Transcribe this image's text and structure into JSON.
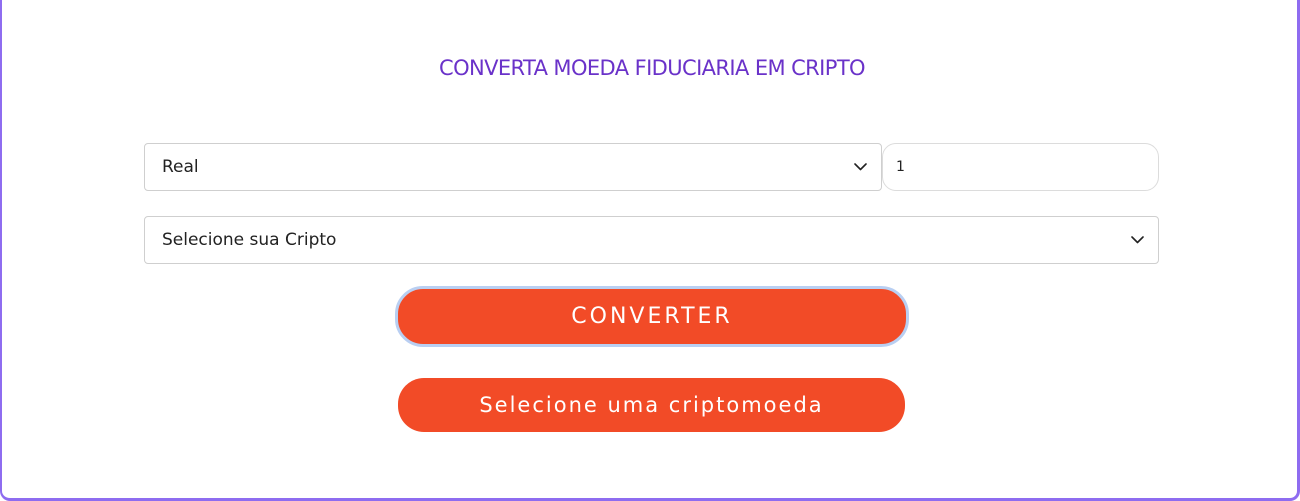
{
  "colors": {
    "title": "#6a32c9",
    "button_bg": "#f24b27",
    "button_text": "#ffffff",
    "frame_border": "#8e6cf0",
    "focus_ring": "#b9cff2"
  },
  "converter": {
    "title": "CONVERTA MOEDA FIDUCIARIA EM CRIPTO",
    "fiat_select": {
      "selected": "Real",
      "icon": "chevron-down-icon"
    },
    "amount_input": {
      "value": "1"
    },
    "crypto_select": {
      "selected": "Selecione sua Cripto",
      "icon": "chevron-down-icon"
    },
    "convert_button": {
      "label": "CONVERTER"
    },
    "result_button": {
      "label": "Selecione uma criptomoeda"
    }
  }
}
